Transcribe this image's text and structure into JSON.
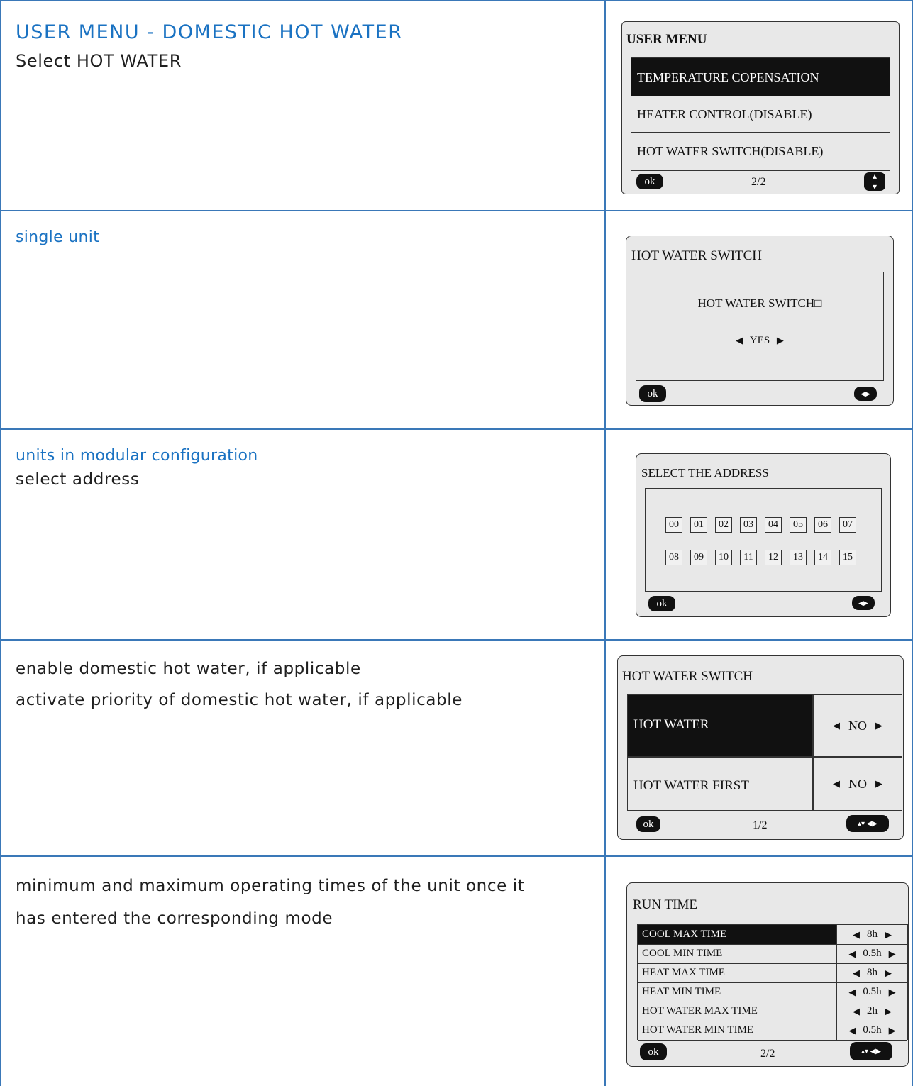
{
  "rows": [
    {
      "heading": "USER MENU - DOMESTIC HOT WATER",
      "lines": [
        "Select HOT WATER"
      ],
      "panel": {
        "title": "USER MENU",
        "items": [
          "TEMPERATURE COPENSATION",
          "HEATER CONTROL(DISABLE)",
          "HOT WATER SWITCH(DISABLE)"
        ],
        "selected_index": 0,
        "ok": "ok",
        "page": "2/2",
        "nav_icon": "up-down-icon"
      }
    },
    {
      "heading": "single unit",
      "lines": [],
      "panel": {
        "title": "HOT WATER SWITCH",
        "prompt": "HOT WATER SWITCH□",
        "value": "YES",
        "ok": "ok",
        "nav_icon": "left-right-icon"
      }
    },
    {
      "heading": "units in modular configuration",
      "lines": [
        "select address"
      ],
      "panel": {
        "title": "SELECT THE ADDRESS",
        "addresses_row1": [
          "00",
          "01",
          "02",
          "03",
          "04",
          "05",
          "06",
          "07"
        ],
        "addresses_row2": [
          "08",
          "09",
          "10",
          "11",
          "12",
          "13",
          "14",
          "15"
        ],
        "ok": "ok",
        "nav_icon": "left-right-icon"
      }
    },
    {
      "lines": [
        "enable domestic hot water, if applicable",
        "activate priority of domestic hot water, if applicable"
      ],
      "panel": {
        "title": "HOT WATER SWITCH",
        "settings": [
          {
            "label": "HOT WATER",
            "value": "NO"
          },
          {
            "label": "HOT WATER FIRST",
            "value": "NO"
          }
        ],
        "selected_index": 0,
        "ok": "ok",
        "page": "1/2",
        "nav_icon": "up-down-left-right-icon"
      }
    },
    {
      "lines": [
        "minimum and maximum operating times of the unit once it",
        "has entered the corresponding mode"
      ],
      "panel": {
        "title": "RUN TIME",
        "settings": [
          {
            "label": "COOL MAX TIME",
            "value": "8h"
          },
          {
            "label": "COOL MIN TIME",
            "value": "0.5h"
          },
          {
            "label": "HEAT MAX TIME",
            "value": "8h"
          },
          {
            "label": "HEAT MIN TIME",
            "value": "0.5h"
          },
          {
            "label": "HOT WATER MAX TIME",
            "value": "2h"
          },
          {
            "label": "HOT WATER MIN TIME",
            "value": "0.5h"
          }
        ],
        "selected_index": 0,
        "ok": "ok",
        "page": "2/2",
        "nav_icon": "up-down-left-right-icon"
      }
    }
  ],
  "colors": {
    "heading": "#1a72c2",
    "border": "#3a78b8",
    "lcd_bg": "#e8e8e8"
  }
}
